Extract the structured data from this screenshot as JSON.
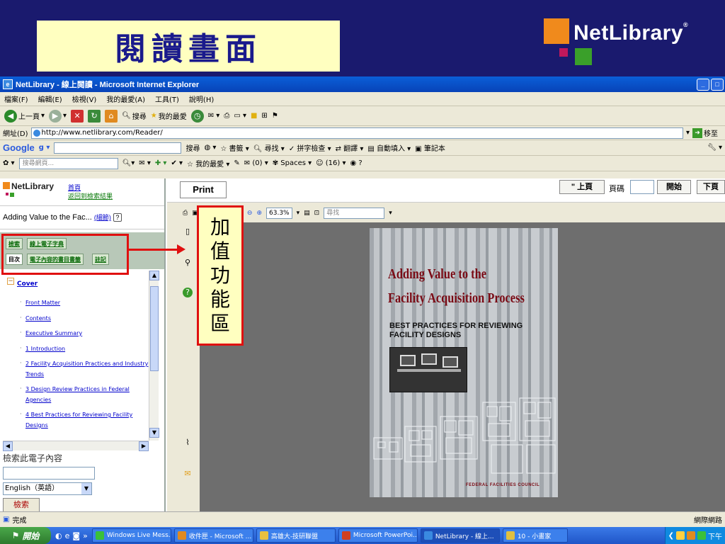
{
  "slide": {
    "title": "閱讀畫面",
    "brand": "NetLibrary",
    "brand_reg": "®"
  },
  "window": {
    "title": "NetLibrary - 線上閱讀 - Microsoft Internet Explorer",
    "menu": [
      "檔案(F)",
      "編輯(E)",
      "檢視(V)",
      "我的最愛(A)",
      "工具(T)",
      "說明(H)"
    ],
    "toolbar": {
      "back": "上一頁",
      "search": "搜尋",
      "favorites": "我的最愛"
    },
    "address": {
      "label": "網址(D)",
      "url": "http://www.netlibrary.com/Reader/",
      "go": "移至"
    },
    "googlebar": {
      "logo": "Google",
      "search": "搜尋",
      "bookmarks": "書籤",
      "find": "尋找",
      "spellcheck": "拼字檢查",
      "translate": "翻譯",
      "autofill": "自動填入",
      "notebook": "筆記本"
    },
    "linkbar": {
      "search_placeholder": "搜尋網頁...",
      "favorites": "我的最愛",
      "mail_count": "(0)",
      "spaces": "Spaces",
      "contacts_count": "(16)"
    },
    "status": {
      "done": "完成",
      "zone": "網際網路"
    }
  },
  "leftpane": {
    "logo": "NetLibrary",
    "home": "首頁",
    "back_to_results": "返回到檢索結果",
    "book_title": "Adding Value to the Fac...",
    "details": "(細節)",
    "help": "?",
    "tabs": {
      "search": "檢索",
      "dictionary": "線上電子字典",
      "toc": "目次",
      "contents_index": "電子內容的書目書籤",
      "notes": "註記"
    },
    "toc_cover": "Cover",
    "toc_items": [
      "Front Matter",
      "Contents",
      "Executive Summary",
      "1 Introduction",
      "2 Facility Acquisition Practices and Industry",
      "Trends",
      "3 Design Review Practices in Federal",
      "Agencies",
      "4 Best Practices for Reviewing Facility",
      "Designs"
    ],
    "search_label": "檢索此電子內容",
    "lang_selected": "English（英語）",
    "search_button": "檢索"
  },
  "viewer": {
    "print": "Print",
    "prev_page": "\" 上頁",
    "page_label": "頁碼",
    "start": "開始",
    "next_page": "下頁",
    "page_current": "1",
    "page_total": "/ 1",
    "zoom": "63.3%",
    "find_placeholder": "尋找"
  },
  "annotation": {
    "chars": [
      "加",
      "值",
      "功",
      "能",
      "區"
    ]
  },
  "cover": {
    "title_line1": "Adding Value to the",
    "title_line2": "Facility Acquisition Process",
    "subtitle_line1": "BEST PRACTICES FOR REVIEWING",
    "subtitle_line2": "FACILITY DESIGNS",
    "footer": "FEDERAL FACILITIES COUNCIL"
  },
  "taskbar": {
    "start": "開始",
    "tasks": [
      "Windows Live Mess...",
      "收件匣 - Microsoft ...",
      "高雄大-技研聯盟",
      "Microsoft PowerPoi...",
      "NetLibrary - 線上...",
      "10 - 小畫家"
    ],
    "clock": "下午"
  },
  "colors": {
    "slide_bg": "#1a1a6e",
    "title_box": "#ffffc0",
    "title_text": "#1a1a8c",
    "highlight_red": "#e01010",
    "cover_title": "#7a0a14"
  }
}
